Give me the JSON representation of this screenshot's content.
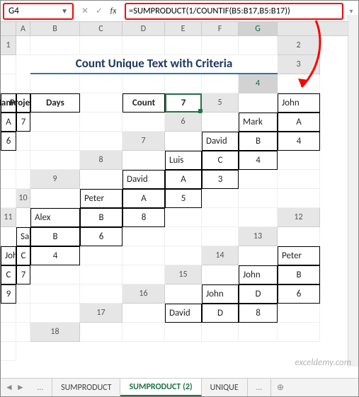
{
  "namebox": {
    "cellRef": "G4"
  },
  "formula": "=SUMPRODUCT(1/COUNTIF(B5:B17,B5:B17))",
  "columns": [
    "A",
    "B",
    "C",
    "D",
    "E",
    "F",
    "G"
  ],
  "rows": [
    "1",
    "2",
    "3",
    "4",
    "5",
    "6",
    "7",
    "8",
    "9",
    "10",
    "11",
    "12",
    "13",
    "14",
    "15",
    "16",
    "17",
    "18"
  ],
  "title": "Count Unique Text with Criteria",
  "headers": {
    "names": "Names",
    "project": "Project",
    "days": "Days"
  },
  "countLabel": "Count",
  "countValue": "7",
  "table": [
    {
      "name": "John",
      "project": "A",
      "days": "7"
    },
    {
      "name": "Mark",
      "project": "A",
      "days": "6"
    },
    {
      "name": "David",
      "project": "B",
      "days": "4"
    },
    {
      "name": "Luis",
      "project": "C",
      "days": "4"
    },
    {
      "name": "David",
      "project": "A",
      "days": "3"
    },
    {
      "name": "Peter",
      "project": "A",
      "days": "5"
    },
    {
      "name": "Alex",
      "project": "B",
      "days": "8"
    },
    {
      "name": "Sara",
      "project": "B",
      "days": "6"
    },
    {
      "name": "John",
      "project": "C",
      "days": "4"
    },
    {
      "name": "Peter",
      "project": "C",
      "days": "7"
    },
    {
      "name": "John",
      "project": "B",
      "days": "9"
    },
    {
      "name": "John",
      "project": "D",
      "days": "6"
    },
    {
      "name": "David",
      "project": "D",
      "days": "8"
    }
  ],
  "tabs": {
    "nav": "…",
    "items": [
      "SUMPRODUCT",
      "SUMPRODUCT (2)",
      "UNIQUE"
    ],
    "activeIndex": 1,
    "more": "…",
    "add": "⊕"
  },
  "watermark": "exceldemy.com",
  "chart_data": {
    "type": "table",
    "title": "Count Unique Text with Criteria",
    "columns": [
      "Names",
      "Project",
      "Days"
    ],
    "rows": [
      [
        "John",
        "A",
        7
      ],
      [
        "Mark",
        "A",
        6
      ],
      [
        "David",
        "B",
        4
      ],
      [
        "Luis",
        "C",
        4
      ],
      [
        "David",
        "A",
        3
      ],
      [
        "Peter",
        "A",
        5
      ],
      [
        "Alex",
        "B",
        8
      ],
      [
        "Sara",
        "B",
        6
      ],
      [
        "John",
        "C",
        4
      ],
      [
        "Peter",
        "C",
        7
      ],
      [
        "John",
        "B",
        9
      ],
      [
        "John",
        "D",
        6
      ],
      [
        "David",
        "D",
        8
      ]
    ],
    "derived": {
      "Count": 7
    }
  }
}
